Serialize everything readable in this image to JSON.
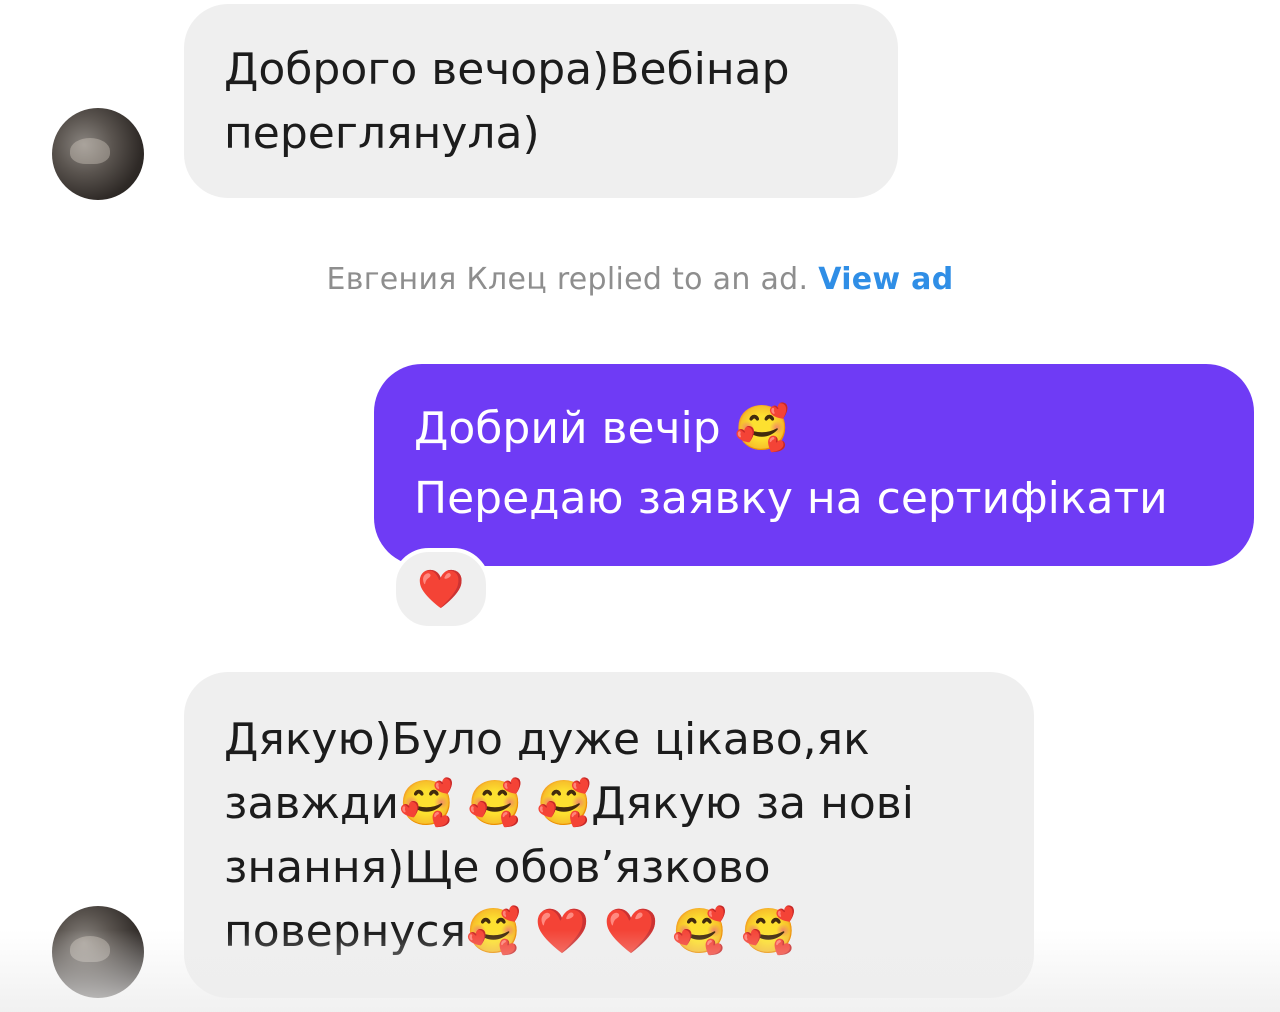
{
  "messages": [
    {
      "direction": "incoming",
      "lines": [
        "Доброго вечора)Вебінар",
        "переглянула)"
      ]
    },
    {
      "direction": "outgoing",
      "lines": [
        "Добрий вечір 🥰",
        "Передаю заявку на сертифікати"
      ],
      "reaction": "❤️"
    },
    {
      "direction": "incoming",
      "lines": [
        "Дякую)Було дуже цікаво,як",
        "завжди🥰 🥰 🥰Дякую за нові",
        "знання)Ще обов’язково",
        "повернуся🥰 ❤️ ❤️ 🥰 🥰"
      ]
    }
  ],
  "notice": {
    "text": "Евгения Клец replied to an ad.",
    "link": "View ad"
  },
  "colors": {
    "outgoing_bubble": "#6f3bf5",
    "incoming_bubble": "#efefef",
    "link": "#2f8ee6",
    "notice_text": "#8e8e8e"
  }
}
